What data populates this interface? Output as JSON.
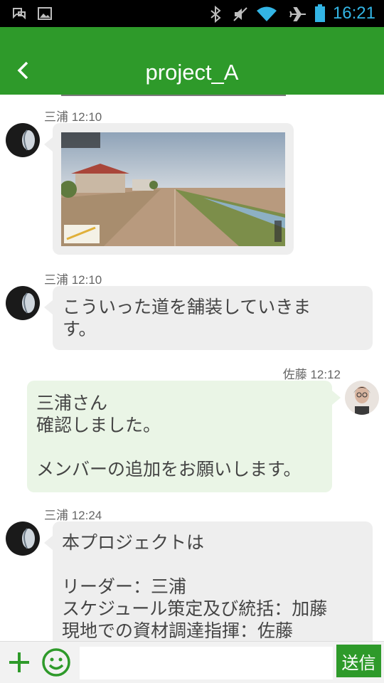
{
  "status_bar": {
    "time": "16:21",
    "icons": [
      "notification-icon",
      "image-notification-icon",
      "bluetooth-icon",
      "mute-icon",
      "wifi-icon",
      "airplane-mode-icon",
      "battery-icon"
    ],
    "time_color": "#33b5e5"
  },
  "header": {
    "title": "project_A",
    "back_icon": "chevron-left-icon",
    "color": "#2e9a2a"
  },
  "messages": [
    {
      "sender": "三浦",
      "time": "12:10",
      "header": "三浦 12:10",
      "type": "image",
      "image_desc": "street-view-photo"
    },
    {
      "sender": "三浦",
      "time": "12:10",
      "header": "三浦 12:10",
      "type": "text",
      "text": "こういった道を舗装していきま\nす。"
    },
    {
      "sender": "佐藤",
      "time": "12:12",
      "header": "佐藤 12:12",
      "type": "text",
      "outgoing": true,
      "text": "三浦さん\n確認しました。\n\nメンバーの追加をお願いします。"
    },
    {
      "sender": "三浦",
      "time": "12:24",
      "header": "三浦 12:24",
      "type": "text",
      "text": "本プロジェクトは\n\nリーダー：三浦\nスケジュール策定及び統括：加藤\n現地での資材調達指揮：佐藤"
    }
  ],
  "input_bar": {
    "placeholder": "",
    "send_label": "送信",
    "add_icon": "plus-icon",
    "emoji_icon": "smiley-icon"
  }
}
